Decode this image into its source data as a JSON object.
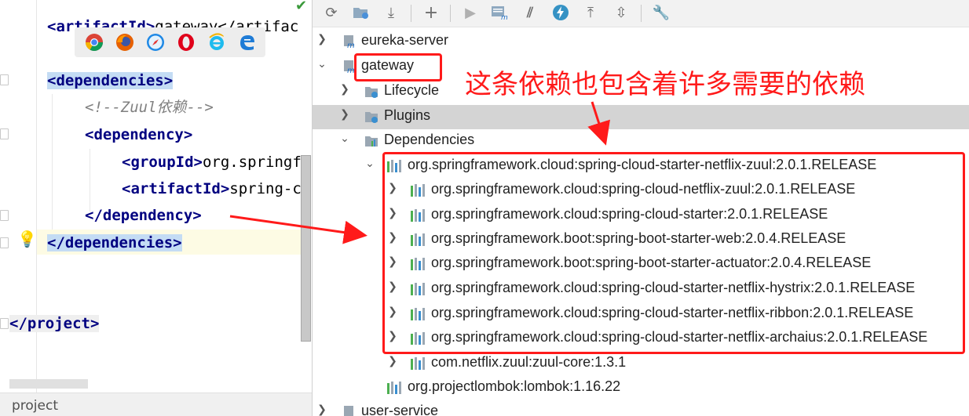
{
  "editor": {
    "lines": {
      "artifact_open": "<artifactId>",
      "artifact_value": "gateway</artifac",
      "deps_open": "<dependencies>",
      "comment": "<!--Zuul依赖-->",
      "dep_open": "<dependency>",
      "group_open": "<groupId>",
      "group_value": "org.springf",
      "artifact2_open": "<artifactId>",
      "artifact2_value": "spring-c",
      "dep_close": "</dependency>",
      "deps_close": "</dependencies>",
      "project_close": "</project>"
    },
    "browser_icons": [
      "chrome-icon",
      "firefox-icon",
      "safari-icon",
      "opera-icon",
      "ie-icon",
      "edge-icon"
    ],
    "status_text": "project"
  },
  "maven": {
    "toolbar": [
      "refresh-icon",
      "reimport-icon",
      "download-icon",
      "add-icon",
      "run-icon",
      "execute-goal-icon",
      "skip-tests-icon",
      "offline-icon",
      "expand-all-icon",
      "collapse-all-icon",
      "settings-icon"
    ],
    "tree": {
      "eureka": "eureka-server",
      "gateway": "gateway",
      "lifecycle": "Lifecycle",
      "plugins": "Plugins",
      "dependencies": "Dependencies",
      "zuul_starter": "org.springframework.cloud:spring-cloud-starter-netflix-zuul:2.0.1.RELEASE",
      "children": [
        "org.springframework.cloud:spring-cloud-netflix-zuul:2.0.1.RELEASE",
        "org.springframework.cloud:spring-cloud-starter:2.0.1.RELEASE",
        "org.springframework.boot:spring-boot-starter-web:2.0.4.RELEASE",
        "org.springframework.boot:spring-boot-starter-actuator:2.0.4.RELEASE",
        "org.springframework.cloud:spring-cloud-starter-netflix-hystrix:2.0.1.RELEASE",
        "org.springframework.cloud:spring-cloud-starter-netflix-ribbon:2.0.1.RELEASE",
        "org.springframework.cloud:spring-cloud-starter-netflix-archaius:2.0.1.RELEASE",
        "com.netflix.zuul:zuul-core:1.3.1"
      ],
      "lombok": "org.projectlombok:lombok:1.16.22",
      "user_service": "user-service"
    }
  },
  "annotation": "这条依赖也包含着许多需要的依赖",
  "colors": {
    "annotation_red": "#ff1a1a",
    "tag_blue": "#000080",
    "selection": "#c4dcf4"
  }
}
